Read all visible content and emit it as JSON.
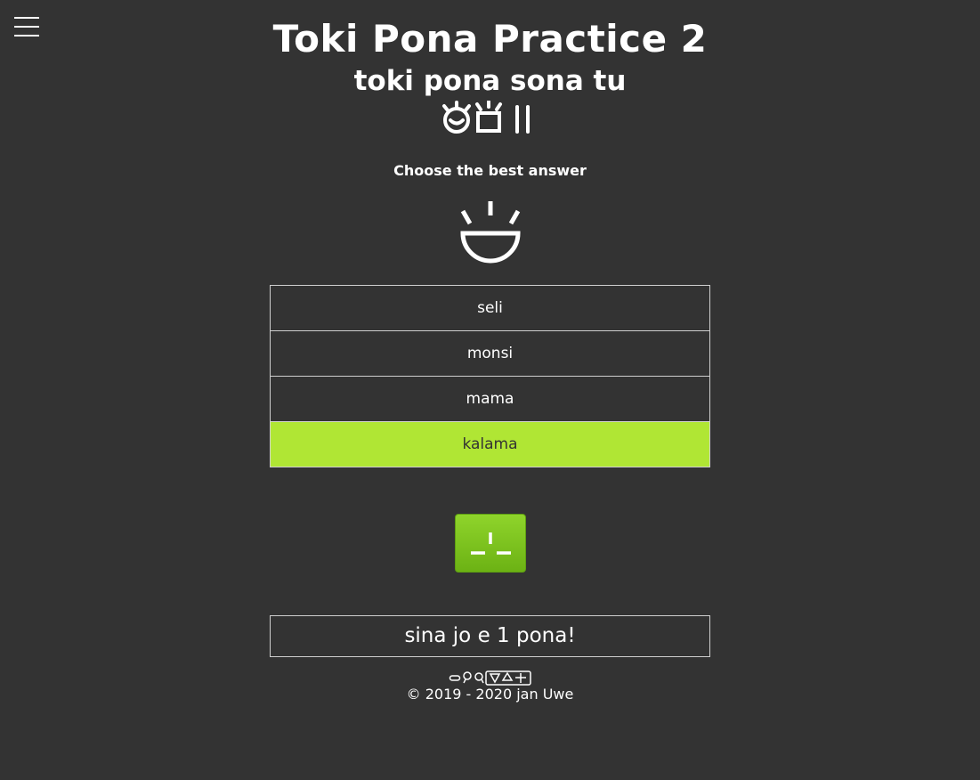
{
  "menu": {
    "icon": "hamburger-menu-icon"
  },
  "header": {
    "title": "Toki Pona Practice 2",
    "subtitle": "toki pona sona tu",
    "subtitle_glyphs": [
      "toki-glyph",
      "sona-glyph",
      "tu-glyph"
    ]
  },
  "quiz": {
    "instruction": "Choose the best answer",
    "question_glyph": "kalama-glyph",
    "options": [
      {
        "label": "seli",
        "selected": false
      },
      {
        "label": "monsi",
        "selected": false
      },
      {
        "label": "mama",
        "selected": false
      },
      {
        "label": "kalama",
        "selected": true
      }
    ],
    "check_button_icon": "pona-glyph-icon",
    "accent_color": "#b0e634"
  },
  "result": {
    "text": "sina jo e 1 pona!"
  },
  "footer": {
    "glyphs": "jan-uwe-cartouche",
    "copyright": "© 2019 - 2020 jan Uwe"
  }
}
